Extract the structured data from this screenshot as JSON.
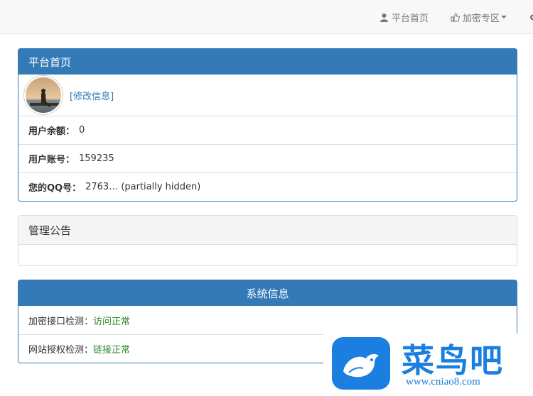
{
  "nav": {
    "home_label": "平台首页",
    "crypto_label": "加密专区"
  },
  "profile_panel": {
    "title": "平台首页",
    "edit_link": "[修改信息]",
    "rows": [
      {
        "label": "用户余额：",
        "value": "0"
      },
      {
        "label": "用户账号：",
        "value": "159235"
      },
      {
        "label": "您的QQ号：",
        "value": "2763… (partially hidden)"
      }
    ]
  },
  "notice_panel": {
    "title": "管理公告",
    "body": ""
  },
  "system_panel": {
    "title": "系统信息",
    "rows": [
      {
        "label": "加密接口检测：",
        "value": "访问正常"
      },
      {
        "label": "网站授权检测：",
        "value": "链接正常"
      }
    ]
  },
  "watermark": {
    "brand": "菜鸟吧",
    "url": "www.cniao8.com"
  },
  "colors": {
    "primary": "#337ab7",
    "ok": "#2c8a2c",
    "logo_blue": "#1a7fe0"
  }
}
